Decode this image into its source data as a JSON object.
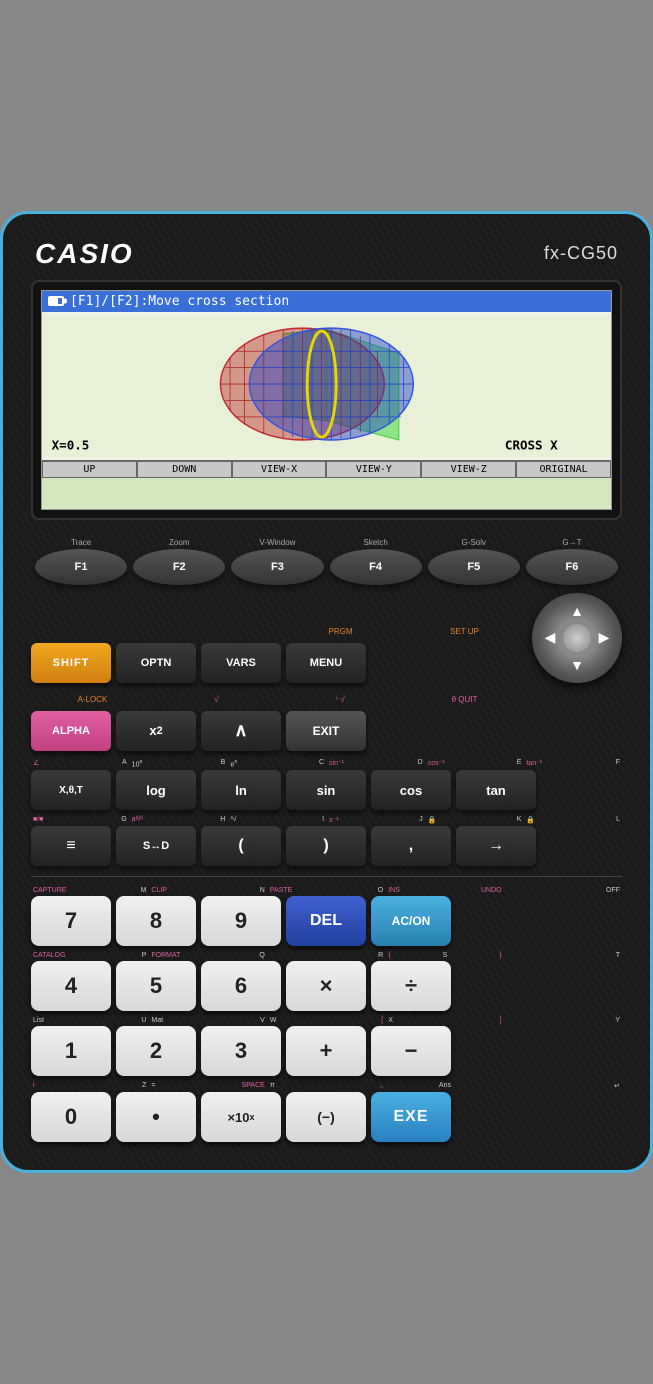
{
  "calculator": {
    "brand": "CASIO",
    "model": "fx-CG50",
    "screen": {
      "header_text": "[F1]/[F2]:Move cross section",
      "x_value": "X=0.5",
      "cross_label": "CROSS X",
      "nav_buttons": [
        "UP",
        "DOWN",
        "VIEW-X",
        "VIEW-Y",
        "VIEW-Z",
        "ORIGINAL"
      ]
    },
    "fkeys": [
      {
        "id": "F1",
        "top_label": "Trace"
      },
      {
        "id": "F2",
        "top_label": "Zoom"
      },
      {
        "id": "F3",
        "top_label": "V-Window"
      },
      {
        "id": "F4",
        "top_label": "Sketch"
      },
      {
        "id": "F5",
        "top_label": "G-Solv"
      },
      {
        "id": "F6",
        "top_label": "G→T"
      }
    ],
    "row_shift_optn": {
      "buttons": [
        {
          "label": "SHIFT",
          "type": "shift"
        },
        {
          "label": "OPTN",
          "type": "dark"
        },
        {
          "label": "VARS",
          "type": "dark",
          "top_label": "PRGM"
        },
        {
          "label": "MENU",
          "type": "dark",
          "top_label": "SET UP"
        }
      ]
    },
    "row_alpha": {
      "buttons": [
        {
          "label": "ALPHA",
          "type": "alpha",
          "top_label": "A-LOCK"
        },
        {
          "label": "x²",
          "type": "dark"
        },
        {
          "label": "∧",
          "type": "dark"
        },
        {
          "label": "EXIT",
          "type": "dark",
          "top_label": "QUIT"
        }
      ]
    },
    "row_math1": {
      "buttons": [
        {
          "label": "X,θ,T",
          "type": "dark"
        },
        {
          "label": "log",
          "type": "dark"
        },
        {
          "label": "ln",
          "type": "dark"
        },
        {
          "label": "sin",
          "type": "dark"
        },
        {
          "label": "cos",
          "type": "dark"
        },
        {
          "label": "tan",
          "type": "dark"
        }
      ]
    },
    "row_math2": {
      "buttons": [
        {
          "label": "÷",
          "type": "dark",
          "display": "■/■"
        },
        {
          "label": "S↔D",
          "type": "dark"
        },
        {
          "label": "(",
          "type": "dark"
        },
        {
          "label": ")",
          "type": "dark"
        },
        {
          "label": ",",
          "type": "dark"
        },
        {
          "label": "→",
          "type": "dark"
        }
      ]
    },
    "numpad": {
      "row1": {
        "labels": {
          "left": "CAPTURE",
          "mid": "M",
          "center_left": "CLIP",
          "center_mid": "N",
          "center_right": "PASTE",
          "center_rmid": "O",
          "right_left": "INS",
          "right_mid": "UNDO",
          "far_right": "OFF"
        },
        "buttons": [
          {
            "label": "7",
            "type": "white"
          },
          {
            "label": "8",
            "type": "white"
          },
          {
            "label": "9",
            "type": "white"
          },
          {
            "label": "DEL",
            "type": "del"
          },
          {
            "label": "AC/ON",
            "type": "blue"
          }
        ]
      },
      "row2": {
        "labels": {
          "b0": "CATALOG",
          "b0m": "P",
          "b1": "FORMAT",
          "b1m": "Q",
          "b2": "R",
          "b3s": "{",
          "b3m": "S",
          "b3e": "}",
          "b4": "T"
        },
        "buttons": [
          {
            "label": "4",
            "type": "white"
          },
          {
            "label": "5",
            "type": "white"
          },
          {
            "label": "6",
            "type": "white"
          },
          {
            "label": "×",
            "type": "white"
          },
          {
            "label": "÷",
            "type": "white",
            "display": "÷"
          }
        ]
      },
      "row3": {
        "labels": {
          "b0": "List",
          "b0m": "U",
          "b1": "Mat",
          "b1m": "V",
          "b2": "W",
          "b2e": "[",
          "b3m": "X",
          "b3e": "]",
          "b4": "Y"
        },
        "buttons": [
          {
            "label": "1",
            "type": "white"
          },
          {
            "label": "2",
            "type": "white"
          },
          {
            "label": "3",
            "type": "white"
          },
          {
            "label": "+",
            "type": "white"
          },
          {
            "label": "−",
            "type": "white"
          }
        ]
      },
      "row4": {
        "labels": {
          "b0": "i",
          "b0m": "Z",
          "b1m": "=",
          "b1": "SPACE",
          "b2": "π",
          "b2m": ",,",
          "b3": "Ans",
          "b4": "↵"
        },
        "buttons": [
          {
            "label": "0",
            "type": "white"
          },
          {
            "label": "•",
            "type": "white"
          },
          {
            "label": "×10x",
            "type": "white"
          },
          {
            "label": "(−)",
            "type": "white"
          },
          {
            "label": "EXE",
            "type": "exe"
          }
        ]
      }
    }
  }
}
